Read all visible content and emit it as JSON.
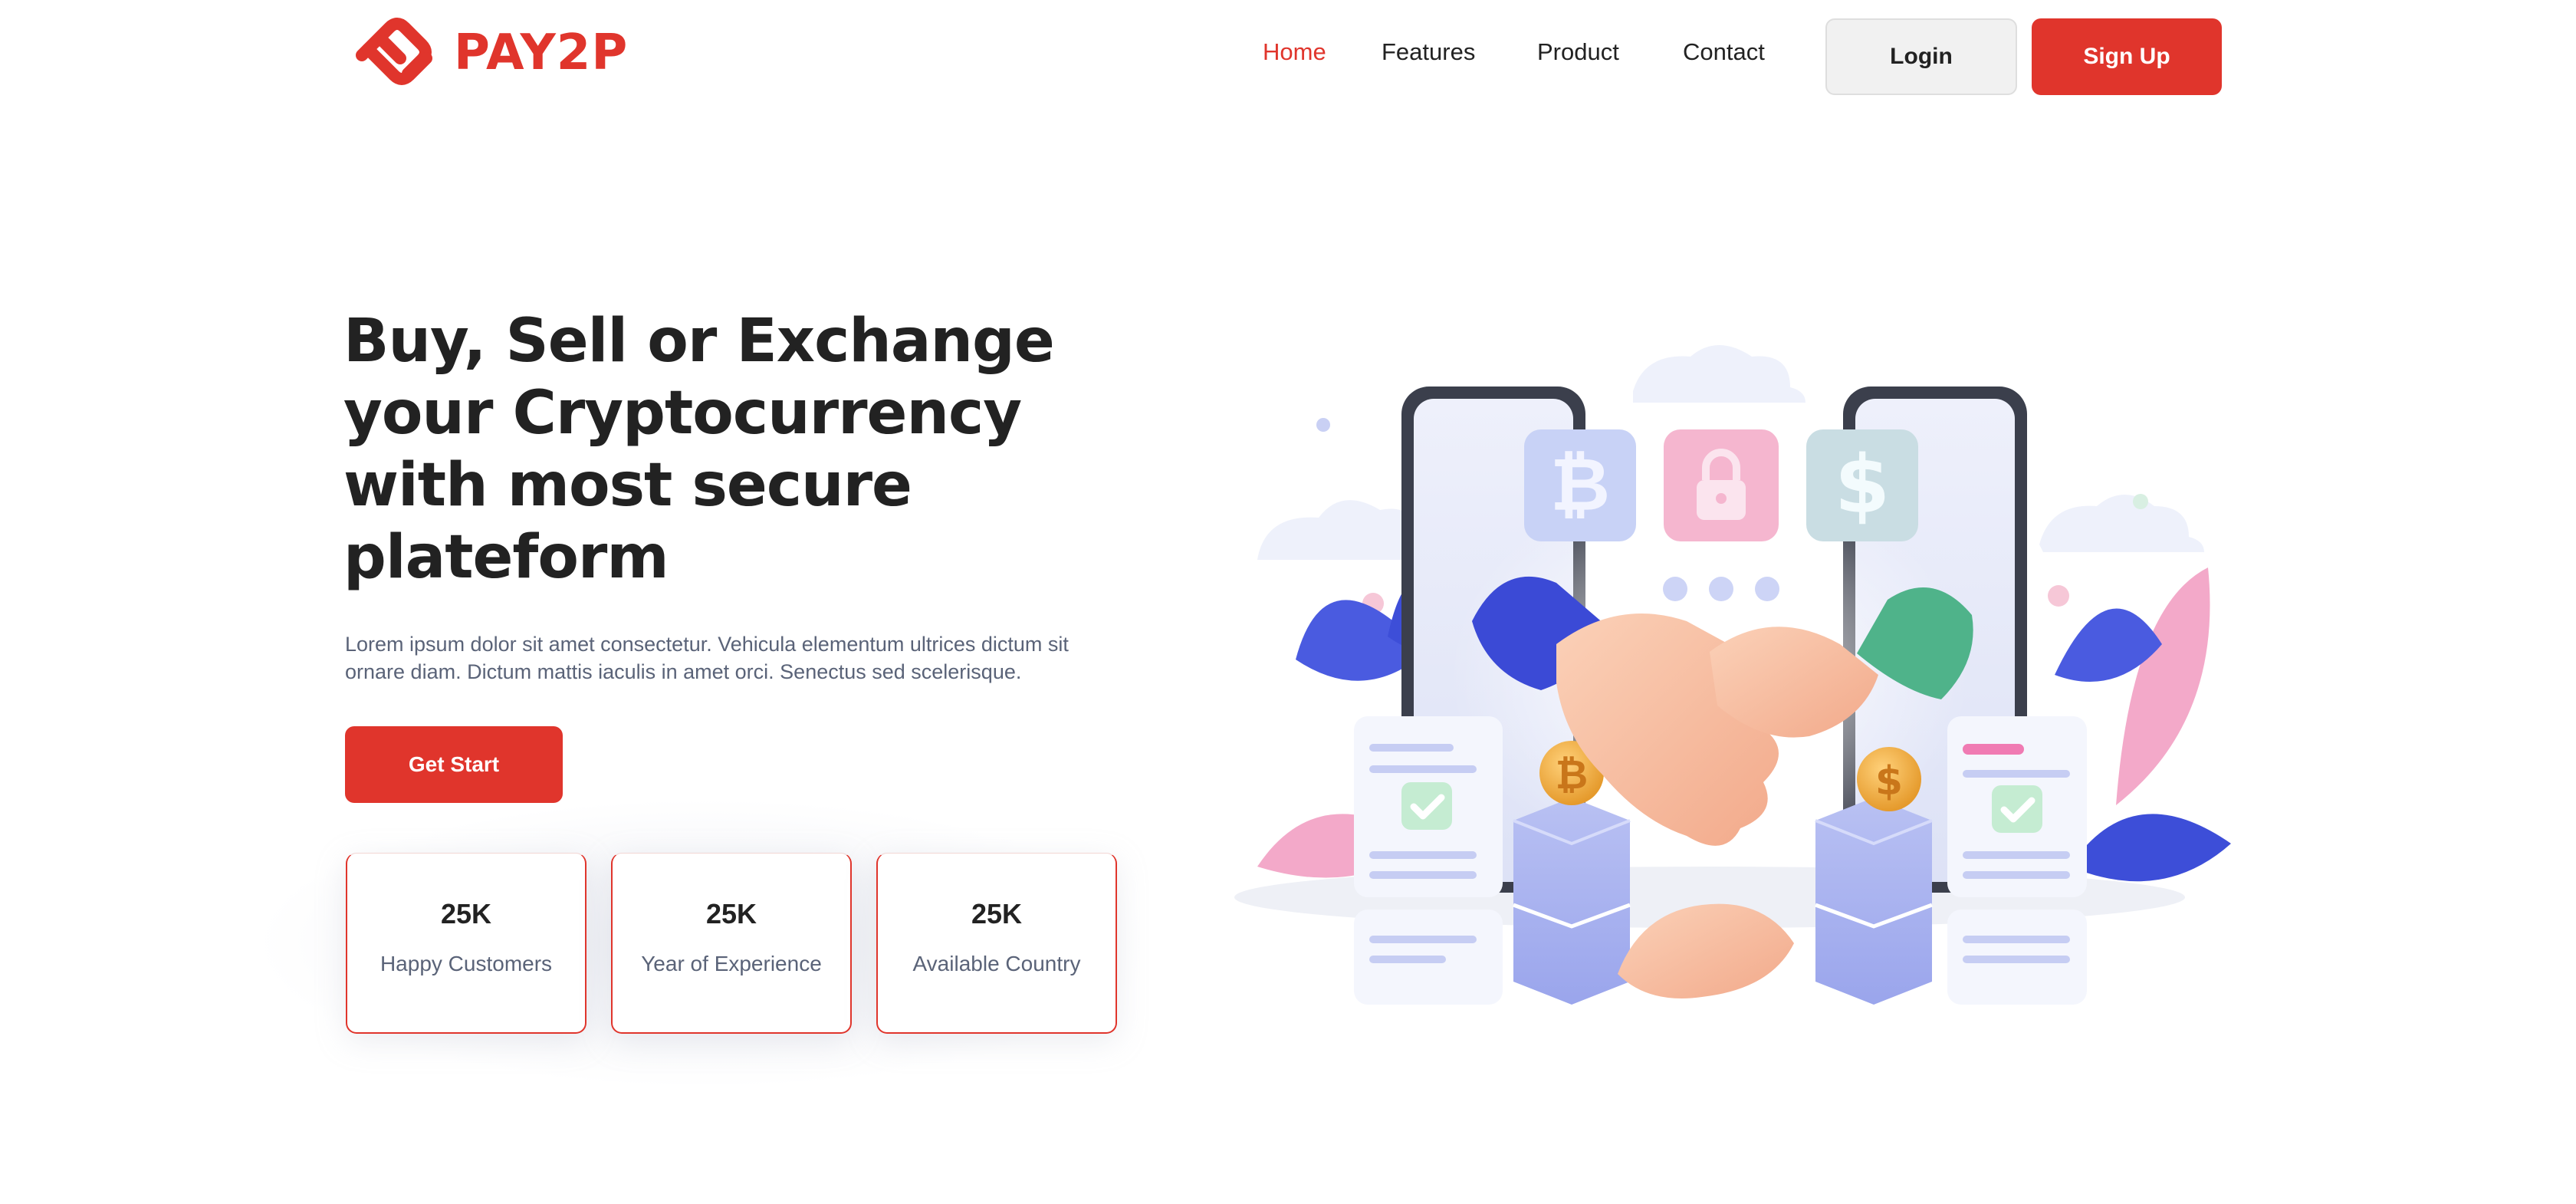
{
  "brand": {
    "name": "PAY2P",
    "accent_color": "#e0352c"
  },
  "nav": {
    "items": [
      {
        "label": "Home",
        "active": true
      },
      {
        "label": "Features",
        "active": false
      },
      {
        "label": "Product",
        "active": false
      },
      {
        "label": "Contact",
        "active": false
      }
    ],
    "login_label": "Login",
    "signup_label": "Sign Up"
  },
  "hero": {
    "title_lines": [
      "Buy, Sell or Exchange",
      "your Cryptocurrency",
      "with most secure",
      "plateform"
    ],
    "description": "Lorem ipsum dolor sit amet consectetur. Vehicula elementum ultrices dictum sit ornare diam. Dictum mattis iaculis in amet orci. Senectus sed scelerisque.",
    "cta_label": "Get Start"
  },
  "stats": [
    {
      "value": "25K",
      "label": "Happy Customers"
    },
    {
      "value": "25K",
      "label": "Year of Experience"
    },
    {
      "value": "25K",
      "label": "Available Country"
    }
  ],
  "illustration": {
    "icons": [
      "bitcoin-icon",
      "lock-icon",
      "dollar-icon",
      "handshake-icon",
      "coin-icon",
      "check-icon"
    ]
  }
}
